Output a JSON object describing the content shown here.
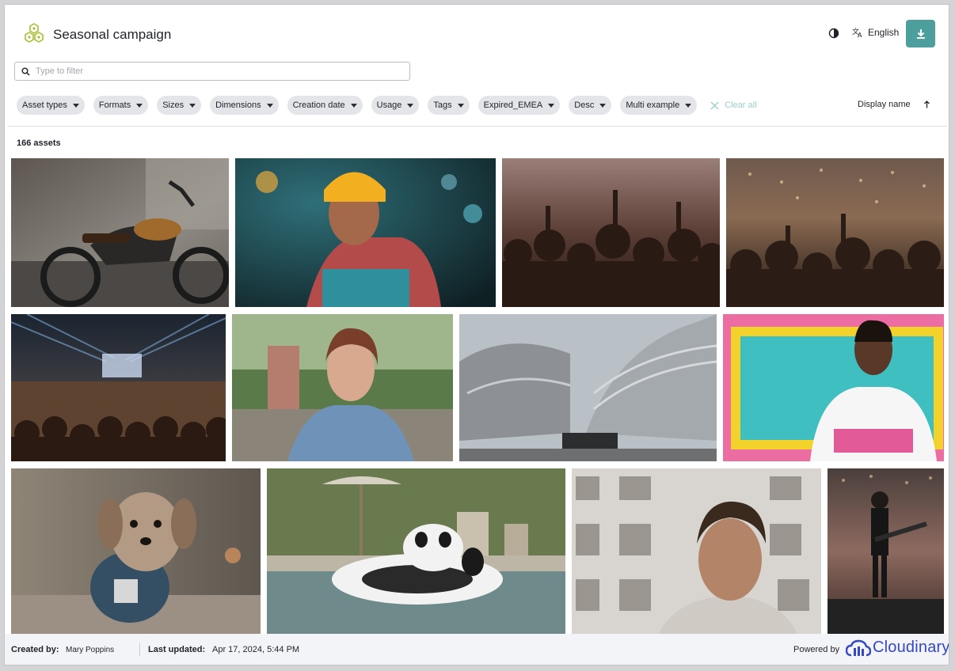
{
  "header": {
    "title": "Seasonal campaign",
    "language": "English",
    "logo_icon": "hexagon-cluster-logo",
    "download_color": "#4c9f9c"
  },
  "search": {
    "placeholder": "Type to filter",
    "value": ""
  },
  "filters": [
    {
      "label": "Asset types"
    },
    {
      "label": "Formats"
    },
    {
      "label": "Sizes"
    },
    {
      "label": "Dimensions"
    },
    {
      "label": "Creation date"
    },
    {
      "label": "Usage"
    },
    {
      "label": "Tags"
    },
    {
      "label": "Expired_EMEA"
    },
    {
      "label": "Desc"
    },
    {
      "label": "Multi example"
    }
  ],
  "clear_all": "Clear all",
  "sort": {
    "label": "Display name",
    "direction_icon": "arrow-up-icon"
  },
  "asset_count": "166 assets",
  "assets": [
    {
      "subject": "motorcycle"
    },
    {
      "subject": "woman-yellow-beanie"
    },
    {
      "subject": "concert-crowd"
    },
    {
      "subject": "concert-crowd-lights"
    },
    {
      "subject": "stadium-concert"
    },
    {
      "subject": "woman-denim-jacket"
    },
    {
      "subject": "modern-building"
    },
    {
      "subject": "man-white-tshirt"
    },
    {
      "subject": "dog-in-tshirt"
    },
    {
      "subject": "panda-pool-float"
    },
    {
      "subject": "man-portrait-building"
    },
    {
      "subject": "guitarist-on-stage"
    }
  ],
  "footer": {
    "created_by_label": "Created by:",
    "created_by": "Mary Poppins",
    "last_updated_label": "Last updated:",
    "last_updated": "Apr 17, 2024, 5:44 PM",
    "powered_by": "Powered by",
    "brand": "Cloudinary",
    "brand_color": "#3448c5"
  }
}
